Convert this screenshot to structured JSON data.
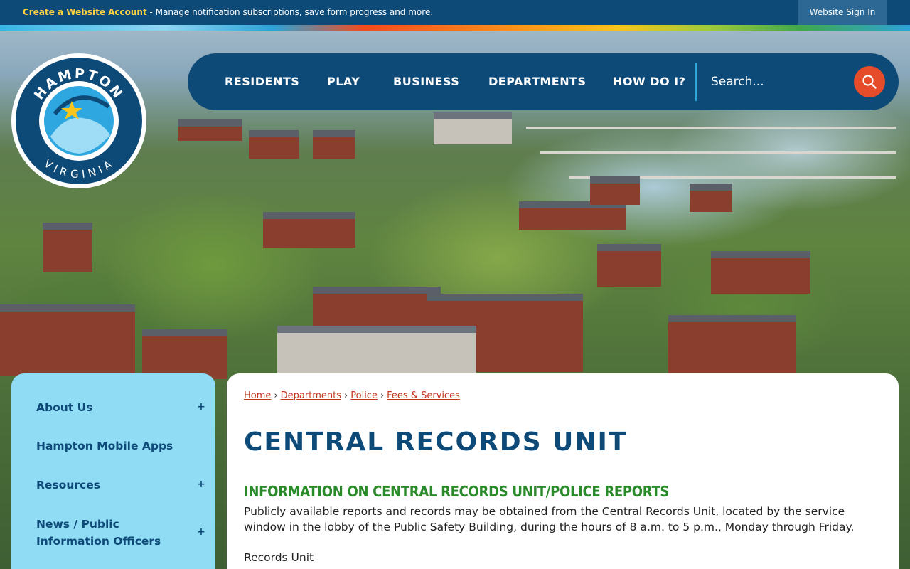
{
  "topbar": {
    "create_account_link": "Create a Website Account",
    "message": " - Manage notification subscriptions, save form progress and more.",
    "signin_label": "Website Sign In"
  },
  "logo": {
    "top_text": "HAMPTON",
    "bottom_text": "VIRGINIA"
  },
  "nav": {
    "items": [
      "RESIDENTS",
      "PLAY",
      "BUSINESS",
      "DEPARTMENTS",
      "HOW DO I?"
    ],
    "search_placeholder": "Search..."
  },
  "sidebar": {
    "items": [
      {
        "label": "About Us",
        "toggle": "+"
      },
      {
        "label": "Hampton Mobile Apps"
      },
      {
        "label": "Resources",
        "toggle": "+"
      },
      {
        "label": "News / Public Information Officers",
        "toggle": "+"
      }
    ]
  },
  "breadcrumb": {
    "items": [
      "Home",
      "Departments",
      "Police",
      "Fees & Services"
    ],
    "separator": "›"
  },
  "content": {
    "title": "CENTRAL RECORDS UNIT",
    "subheading": "INFORMATION ON CENTRAL RECORDS UNIT/POLICE REPORTS",
    "paragraph": "Publicly available reports and records may be obtained from the Central Records Unit, located by the service window in the lobby of the Public Safety Building, during the hours of 8 a.m. to 5 p.m., Monday through Friday.",
    "records_label": "Records Unit"
  },
  "colors": {
    "brand_navy": "#0e4a78",
    "accent_orange": "#e64b2a",
    "sidebar_blue": "#91dcf5",
    "heading_green": "#2a8a2a",
    "link_red": "#c2361b"
  },
  "icons": {
    "search": "search-icon",
    "expand": "plus-icon"
  }
}
